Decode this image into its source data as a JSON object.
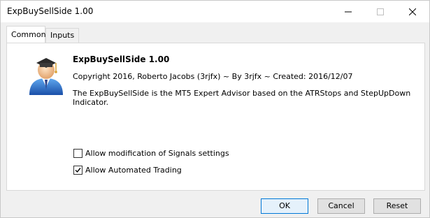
{
  "window": {
    "title": "ExpBuySellSide 1.00"
  },
  "tabs": [
    {
      "label": "Common",
      "active": true
    },
    {
      "label": "Inputs",
      "active": false
    }
  ],
  "common": {
    "logo_icon": "graduate-user-icon",
    "ea_title": "ExpBuySellSide 1.00",
    "copyright": "Copyright 2016, Roberto Jacobs (3rjfx) ~ By 3rjfx ~ Created: 2016/12/07",
    "description": "The ExpBuySellSide is the MT5 Expert Advisor based on the ATRStops and StepUpDown Indicator.",
    "allow_signals_label": "Allow modification of Signals settings",
    "allow_signals_checked": false,
    "allow_trading_label": "Allow Automated Trading",
    "allow_trading_checked": true
  },
  "buttons": {
    "ok": "OK",
    "cancel": "Cancel",
    "reset": "Reset"
  },
  "colors": {
    "accent": "#0078d7",
    "window_bg": "#f0f0f0"
  }
}
